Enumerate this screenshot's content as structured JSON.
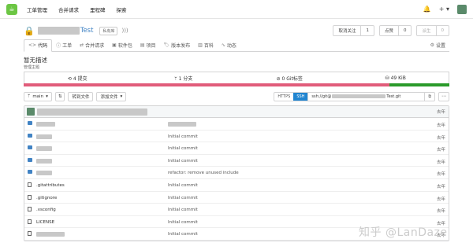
{
  "nav": [
    "工单管理",
    "合并请求",
    "里程碑",
    "探索"
  ],
  "topright": {
    "bell": "🔔",
    "plus": "+ ▾"
  },
  "repo": {
    "name_suffix": "Test",
    "private_tag": "私有库",
    "watch": {
      "label": "取消关注",
      "count": "1"
    },
    "star": {
      "label": "点赞",
      "count": "0"
    },
    "fork": {
      "label": "派生",
      "count": "0"
    }
  },
  "tabs": [
    {
      "icon": "<>",
      "label": "代码",
      "active": true
    },
    {
      "icon": "ⓘ",
      "label": "工单"
    },
    {
      "icon": "⇄",
      "label": "合并请求"
    },
    {
      "icon": "▣",
      "label": "软件包"
    },
    {
      "icon": "▤",
      "label": "项目"
    },
    {
      "icon": "🏷",
      "label": "版本发布"
    },
    {
      "icon": "▥",
      "label": "百科"
    },
    {
      "icon": "∿",
      "label": "动态"
    }
  ],
  "settings_label": "设置",
  "description": "暂无描述",
  "topic": "管理主题",
  "stats": {
    "commits": "4 提交",
    "branches": "1 分支",
    "tags": "0 Git标签",
    "size": "49 KiB"
  },
  "toolbar": {
    "branch": "main",
    "goto_file": "转到文件",
    "add_file": "添加文件",
    "https": "HTTPS",
    "ssh": "SSH",
    "url_prefix": "ssh://git@",
    "url_suffix": "Test.git"
  },
  "last_commit_time": "去年",
  "files": [
    {
      "type": "folder",
      "name": "",
      "msg": "",
      "time": "去年"
    },
    {
      "type": "folder",
      "name": "",
      "msg": "Initial commit",
      "time": "去年"
    },
    {
      "type": "folder",
      "name": "",
      "msg": "Initial commit",
      "time": "去年"
    },
    {
      "type": "folder",
      "name": "",
      "msg": "Initial commit",
      "time": "去年"
    },
    {
      "type": "folder",
      "name": "",
      "msg": "refactor: remove unused include",
      "time": "去年"
    },
    {
      "type": "file",
      "name": ".gitattributes",
      "msg": "Initial commit",
      "time": "去年"
    },
    {
      "type": "file",
      "name": ".gitignore",
      "msg": "Initial commit",
      "time": "去年"
    },
    {
      "type": "file",
      "name": ".vsconfig",
      "msg": "Initial commit",
      "time": "去年"
    },
    {
      "type": "file",
      "name": "LICENSE",
      "msg": "Initial commit",
      "time": "去年"
    },
    {
      "type": "file",
      "name": "",
      "msg": "Initial commit",
      "time": "去年"
    }
  ],
  "colors": {
    "accent": "#2185d0",
    "lang1": "#e15c7a",
    "lang2": "#2a9a2a"
  },
  "watermark": "知乎 @LanDaze"
}
